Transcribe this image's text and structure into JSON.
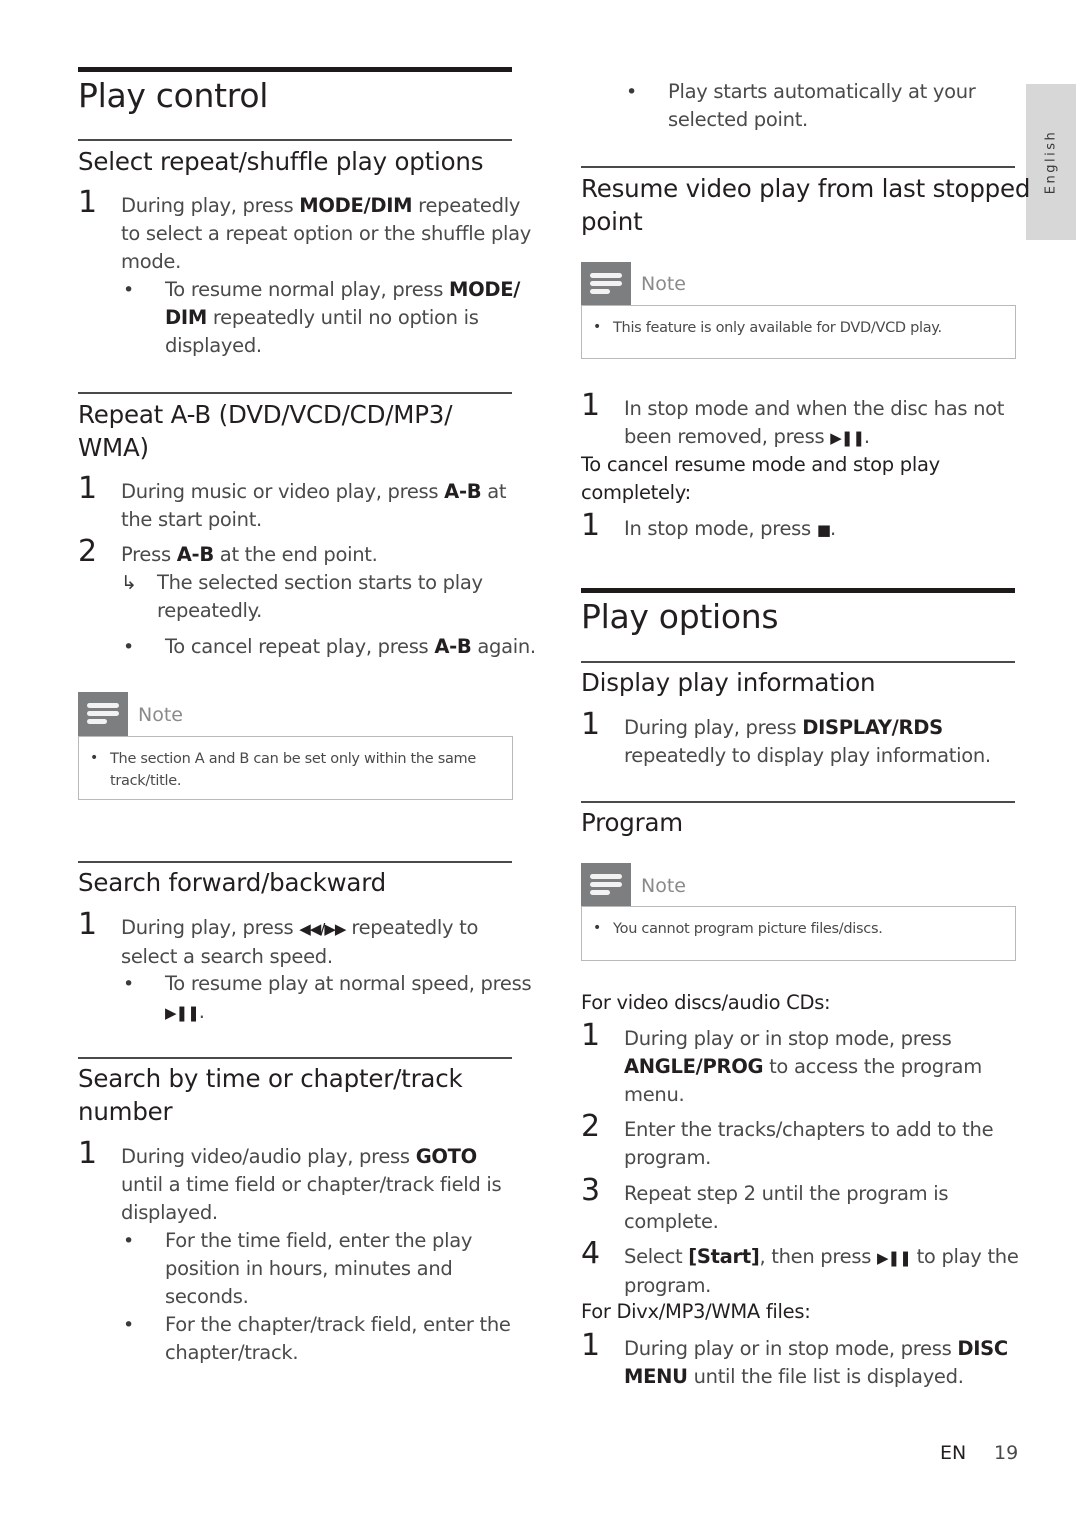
{
  "side_tab": {
    "language": "English"
  },
  "left": {
    "section_title": "Play control",
    "repeat_shuffle": {
      "heading": "Select repeat/shuffle play options",
      "step1": {
        "num": "1",
        "lines": [
          "During play, press ",
          "MODE/DIM",
          " repeatedly",
          "to select a repeat option or the shuffle play",
          "mode."
        ]
      },
      "bullet1": {
        "lines": [
          "To resume normal play, press ",
          "MODE/",
          "DIM",
          " repeatedly until no option is",
          "displayed."
        ]
      }
    },
    "repeat_ab": {
      "heading_line1": "Repeat A-B (DVD/VCD/CD/MP3/",
      "heading_line2": "WMA)",
      "step1": {
        "num": "1",
        "pre": "During music or video play, press ",
        "key": "A-B",
        "post": " at",
        "line2": "the start point."
      },
      "step2": {
        "num": "2",
        "pre": "Press ",
        "key": "A-B",
        "post": " at the end point."
      },
      "result": {
        "line1": "The selected section starts to play",
        "line2": "repeatedly."
      },
      "bullet1": {
        "pre": "To cancel repeat play, press ",
        "key": "A-B",
        "post": " again."
      },
      "note": {
        "title": "Note",
        "line1": "The section A and B can be set only within the same",
        "line2": "track/title."
      }
    },
    "search_fb": {
      "heading": "Search forward/backward",
      "step1": {
        "num": "1",
        "pre": "During play, press ",
        "symbol": "◀◀/▶▶",
        "post": " repeatedly to",
        "line2": "select a search speed."
      },
      "bullet1": {
        "line1": "To resume play at normal speed, press",
        "symbol": "▶❚❚",
        "post": "."
      }
    },
    "search_time": {
      "heading_line1": "Search by time or chapter/track",
      "heading_line2": "number",
      "step1": {
        "num": "1",
        "pre": "During video/audio play, press ",
        "key": "GOTO",
        "line2": "until a time field or chapter/track field is",
        "line3": "displayed."
      },
      "bullet1": {
        "line1": "For the time field, enter the play",
        "line2": "position in hours, minutes and",
        "line3": "seconds."
      },
      "bullet2": {
        "line1": "For the chapter/track field, enter the",
        "line2": "chapter/track."
      }
    }
  },
  "right": {
    "cont_bullet": {
      "line1": "Play starts automatically at your",
      "line2": "selected point."
    },
    "resume": {
      "heading_line1": "Resume video play from last stopped",
      "heading_line2": "point",
      "note": {
        "title": "Note",
        "line1": "This feature is only available for DVD/VCD play."
      },
      "step1": {
        "num": "1",
        "line1": "In stop mode and when the disc has not",
        "pre2": "been removed, press ",
        "symbol": "▶❚❚",
        "post2": "."
      },
      "cancel_label_line1": "To cancel resume mode and stop play",
      "cancel_label_line2": "completely:",
      "step2": {
        "num": "1",
        "pre": "In stop mode, press ",
        "symbol": "■",
        "post": "."
      }
    },
    "section_title": "Play options",
    "display_info": {
      "heading": "Display play information",
      "step1": {
        "num": "1",
        "pre": "During play, press ",
        "key": "DISPLAY/RDS",
        "line2": "repeatedly to display play information."
      }
    },
    "program": {
      "heading": "Program",
      "note": {
        "title": "Note",
        "line1": "You cannot program picture files/discs."
      },
      "video_label": "For video discs/audio CDs:",
      "step1": {
        "num": "1",
        "line1": "During play or in stop mode, press",
        "key": "ANGLE/PROG",
        "post2": " to access the program",
        "line3": "menu."
      },
      "step2": {
        "num": "2",
        "line1": "Enter the tracks/chapters to add to the",
        "line2": "program."
      },
      "step3": {
        "num": "3",
        "line1": "Repeat step 2 until the program is",
        "line2": "complete."
      },
      "step4": {
        "num": "4",
        "pre": "Select ",
        "key": "[Start]",
        "mid": ", then press ",
        "symbol": "▶❚❚",
        "post": " to play the",
        "line2": "program."
      },
      "divx_label": "For Divx/MP3/WMA files:",
      "step5": {
        "num": "1",
        "pre": "During play or in stop mode, press ",
        "key1": "DISC",
        "key2": "MENU",
        "post2": " until the file list is displayed."
      }
    }
  },
  "footer": {
    "lang": "EN",
    "page": "19"
  }
}
